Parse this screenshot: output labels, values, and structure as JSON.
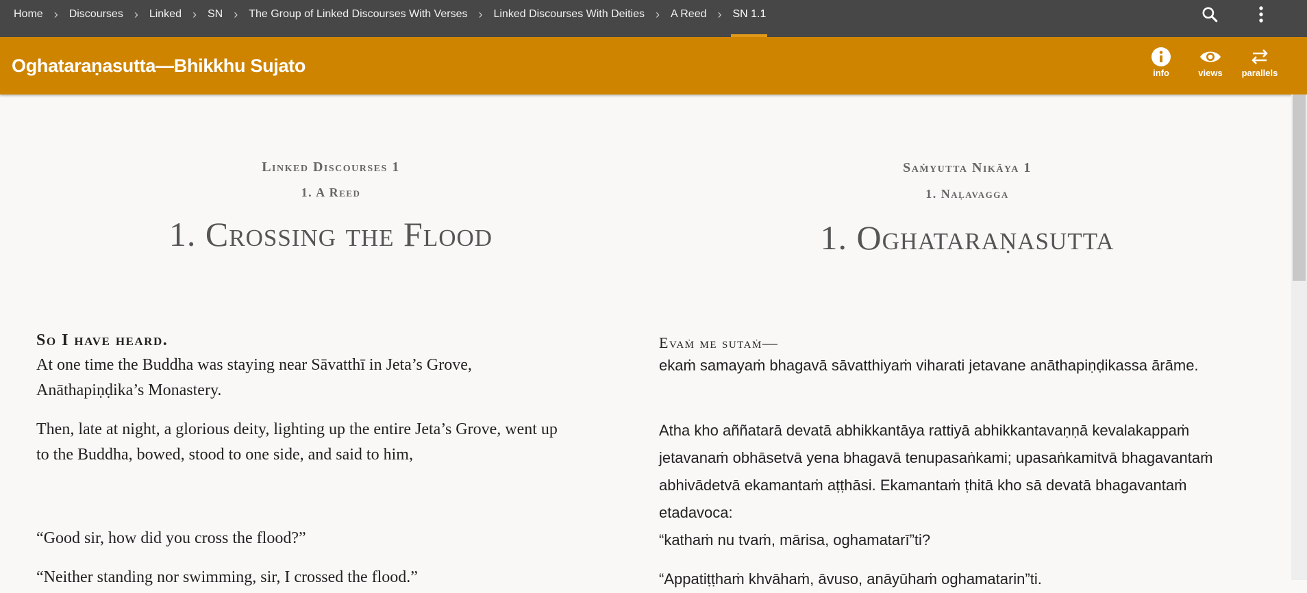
{
  "breadcrumbs": [
    {
      "label": "Home"
    },
    {
      "label": "Discourses"
    },
    {
      "label": "Linked"
    },
    {
      "label": "SN"
    },
    {
      "label": "The Group of Linked Discourses With Verses"
    },
    {
      "label": "Linked Discourses With Deities"
    },
    {
      "label": "A Reed"
    },
    {
      "label": "SN 1.1",
      "active": true
    }
  ],
  "topbar": {
    "search_icon": "search-icon",
    "more_icon": "more-vert-icon"
  },
  "titlebar": {
    "title": "Oghataraṇasutta—Bhikkhu Sujato",
    "color": "#cf8400",
    "buttons": {
      "info": "info",
      "views": "views",
      "parallels": "parallels"
    }
  },
  "translation": {
    "division": "Linked Discourses 1",
    "vagga": "1. A Reed",
    "title": "1. Crossing the Flood",
    "evam": "So I have heard.",
    "p1a": "At one time the Buddha was staying near Sāvatthī in Jeta’s Grove,",
    "p1b": "Anāthapiṇḍika’s Monastery.",
    "p2a": "Then, late at night, a glorious deity, lighting up the entire Jeta’s Grove, went up",
    "p2b": "to the Buddha, bowed, stood to one side, and said to him,",
    "p3": "“Good sir, how did you cross the flood?”",
    "p4": "“Neither standing nor swimming, sir, I crossed the flood.”"
  },
  "root": {
    "division": "Saṁyutta Nikāya 1",
    "vagga": "1. Naḷavagga",
    "title": "1. Oghataraṇasutta",
    "evam": "Evaṁ me sutaṁ—",
    "p1": "ekaṁ samayaṁ bhagavā sāvatthiyaṁ viharati jetavane anāthapiṇḍikassa ārāme.",
    "p2a": "Atha kho aññatarā devatā abhikkantāya rattiyā abhikkantavaṇṇā kevalakappaṁ",
    "p2b": "jetavanaṁ obhāsetvā yena bhagavā tenupasaṅkami; upasaṅkamitvā bhagavantaṁ",
    "p2c": "abhivādetvā ekamantaṁ aṭṭhāsi. Ekamantaṁ ṭhitā kho sā devatā bhagavantaṁ",
    "p2d": "etadavoca:",
    "p3": "“kathaṁ nu tvaṁ, mārisa, oghamatarī”ti?",
    "p4": "“Appatiṭṭhaṁ khvāhaṁ, āvuso, anāyūhaṁ oghamatarin”ti."
  }
}
